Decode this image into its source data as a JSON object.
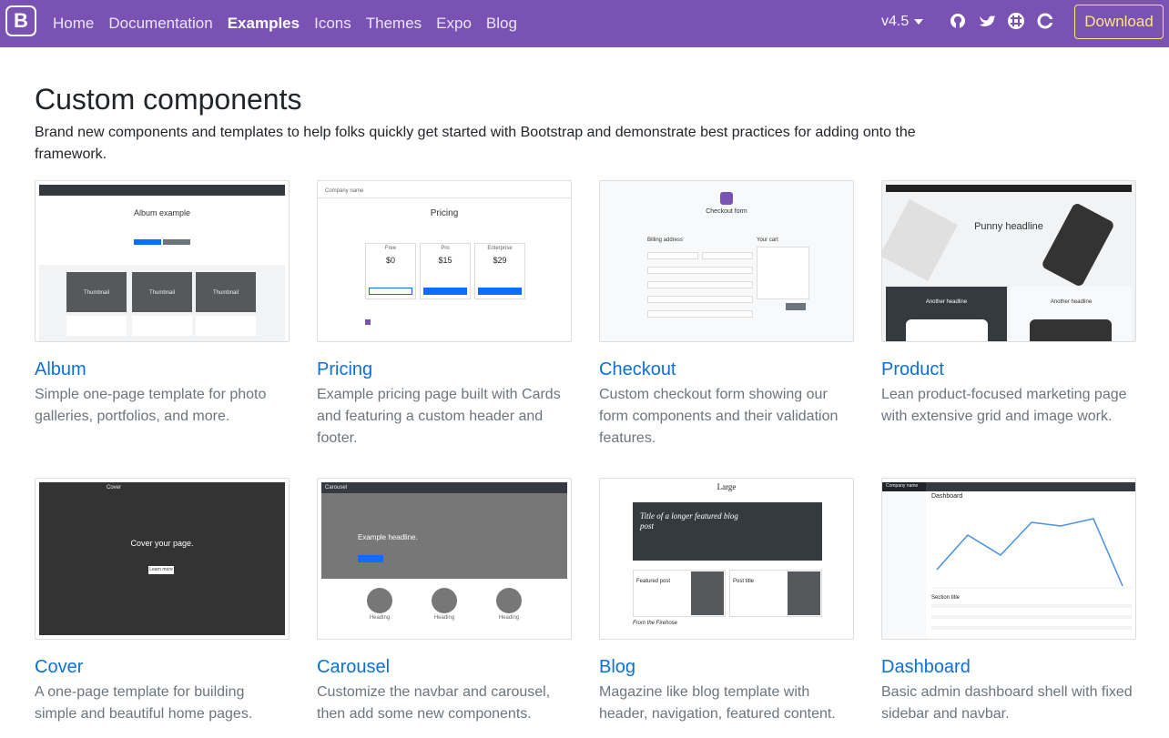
{
  "navbar": {
    "brand": "B",
    "links": [
      "Home",
      "Documentation",
      "Examples",
      "Icons",
      "Themes",
      "Expo",
      "Blog"
    ],
    "active": "Examples",
    "version": "v4.5",
    "download": "Download"
  },
  "header": {
    "title": "Custom components",
    "lead": "Brand new components and templates to help folks quickly get started with Bootstrap and demonstrate best practices for adding onto the framework."
  },
  "cards": [
    {
      "title": "Album",
      "desc": "Simple one-page template for photo galleries, portfolios, and more."
    },
    {
      "title": "Pricing",
      "desc": "Example pricing page built with Cards and featuring a custom header and footer."
    },
    {
      "title": "Checkout",
      "desc": "Custom checkout form showing our form components and their validation features."
    },
    {
      "title": "Product",
      "desc": "Lean product-focused marketing page with extensive grid and image work."
    },
    {
      "title": "Cover",
      "desc": "A one-page template for building simple and beautiful home pages."
    },
    {
      "title": "Carousel",
      "desc": "Customize the navbar and carousel, then add some new components."
    },
    {
      "title": "Blog",
      "desc": "Magazine like blog template with header, navigation, featured content."
    },
    {
      "title": "Dashboard",
      "desc": "Basic admin dashboard shell with fixed sidebar and navbar."
    }
  ],
  "thumbs": {
    "album": {
      "heading": "Album example",
      "tile": "Thumbnail"
    },
    "pricing": {
      "company": "Company name",
      "heading": "Pricing",
      "tiers": [
        "Free",
        "Pro",
        "Enterprise"
      ],
      "prices": [
        "$0",
        "$15",
        "$29"
      ],
      "buttons": [
        "Sign up for free",
        "Get started",
        "Contact us"
      ]
    },
    "checkout": {
      "heading": "Checkout form",
      "billing": "Billing address",
      "cart": "Your cart"
    },
    "product": {
      "heading": "Punny headline",
      "sub": "Another headline"
    },
    "cover": {
      "brand": "Cover",
      "heading": "Cover your page.",
      "button": "Learn more"
    },
    "carousel": {
      "brand": "Carousel",
      "heading": "Example headline.",
      "col": "Heading"
    },
    "blog": {
      "brand": "Large",
      "featured": "Title of a longer featured blog post",
      "post1": "Featured post",
      "post2": "Post title",
      "from": "From the Firehose"
    },
    "dashboard": {
      "brand": "Company name",
      "heading": "Dashboard",
      "section": "Section title"
    }
  },
  "colors": {
    "navbar": "#7952b3",
    "link": "#0c70d6",
    "download": "#ffe484"
  }
}
